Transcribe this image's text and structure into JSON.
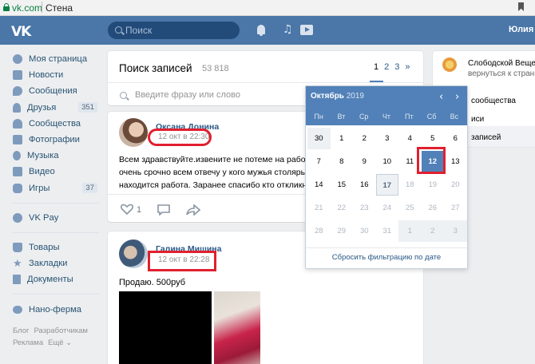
{
  "browser": {
    "domain": "vk.com",
    "page_title": "Стена"
  },
  "header": {
    "logo": "VK",
    "search_placeholder": "Поиск",
    "user_name": "Юлия"
  },
  "nav": {
    "items": [
      {
        "label": "Моя страница",
        "icon": "home-icon"
      },
      {
        "label": "Новости",
        "icon": "news-icon"
      },
      {
        "label": "Сообщения",
        "icon": "messages-icon"
      },
      {
        "label": "Друзья",
        "icon": "friends-icon",
        "count": "351"
      },
      {
        "label": "Сообщества",
        "icon": "groups-icon"
      },
      {
        "label": "Фотографии",
        "icon": "photos-icon"
      },
      {
        "label": "Музыка",
        "icon": "music-icon"
      },
      {
        "label": "Видео",
        "icon": "video-icon"
      },
      {
        "label": "Игры",
        "icon": "games-icon",
        "count": "37"
      }
    ],
    "pay": {
      "label": "VK Pay",
      "icon": "vkpay-icon"
    },
    "items2": [
      {
        "label": "Товары",
        "icon": "goods-icon"
      },
      {
        "label": "Закладки",
        "icon": "bookmarks-icon"
      },
      {
        "label": "Документы",
        "icon": "documents-icon"
      }
    ],
    "app": {
      "label": "Нано-ферма",
      "icon": "app-icon"
    },
    "footer": {
      "blog": "Блог",
      "dev": "Разработчикам",
      "ads": "Реклама",
      "more": "Ещё ⌄"
    }
  },
  "search_card": {
    "title": "Поиск записей",
    "count": "53 818",
    "pages": [
      "1",
      "2",
      "3",
      "»"
    ],
    "input_placeholder": "Введите фразу или слово"
  },
  "post1": {
    "author": "Оксана Донина",
    "date": "12 окт в 22:30",
    "text_lines": [
      "Всем здравствуйте.извените не потеме на работу мя",
      "очень срочно всем отвечу у кого мужья столяры обь",
      "находится работа. Заранее спасибо кто откликнется"
    ],
    "likes": "1"
  },
  "post2": {
    "author": "Галина Мишина",
    "date": "12 окт в 22:28",
    "text": "Продаю. 500руб"
  },
  "right_card": {
    "name": "Слободской Вещево",
    "sub": "вернуться к страниц",
    "link1": "сообщества",
    "link2": "иси",
    "link3": "записей"
  },
  "calendar": {
    "month": "Октябрь",
    "year": "2019",
    "weekdays": [
      "Пн",
      "Вт",
      "Ср",
      "Чт",
      "Пт",
      "Сб",
      "Вс"
    ],
    "weeks": [
      [
        "30",
        "1",
        "2",
        "3",
        "4",
        "5",
        "6"
      ],
      [
        "7",
        "8",
        "9",
        "10",
        "11",
        "12",
        "13"
      ],
      [
        "14",
        "15",
        "16",
        "17",
        "18",
        "19",
        "20"
      ],
      [
        "21",
        "22",
        "23",
        "24",
        "25",
        "26",
        "27"
      ],
      [
        "28",
        "29",
        "30",
        "31",
        "1",
        "2",
        "3"
      ]
    ],
    "selected": "12",
    "today": "17",
    "reset_label": "Сбросить фильтрацию по дате"
  }
}
